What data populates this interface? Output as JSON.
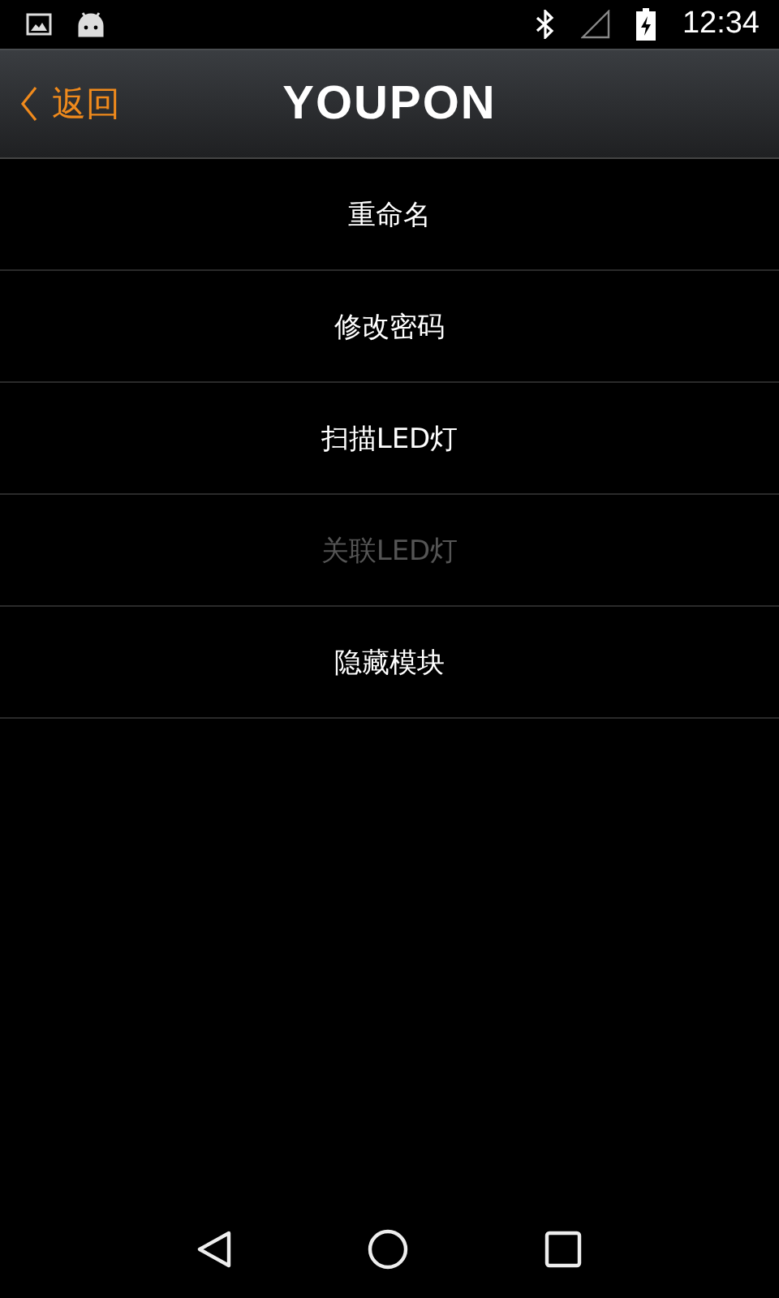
{
  "status_bar": {
    "time": "12:34"
  },
  "header": {
    "back": "返回",
    "title": "YOUPON"
  },
  "menu": [
    {
      "label": "重命名",
      "disabled": false
    },
    {
      "label": "修改密码",
      "disabled": false
    },
    {
      "label": "扫描LED灯",
      "disabled": false
    },
    {
      "label": "关联LED灯",
      "disabled": true
    },
    {
      "label": "隐藏模块",
      "disabled": false
    }
  ]
}
